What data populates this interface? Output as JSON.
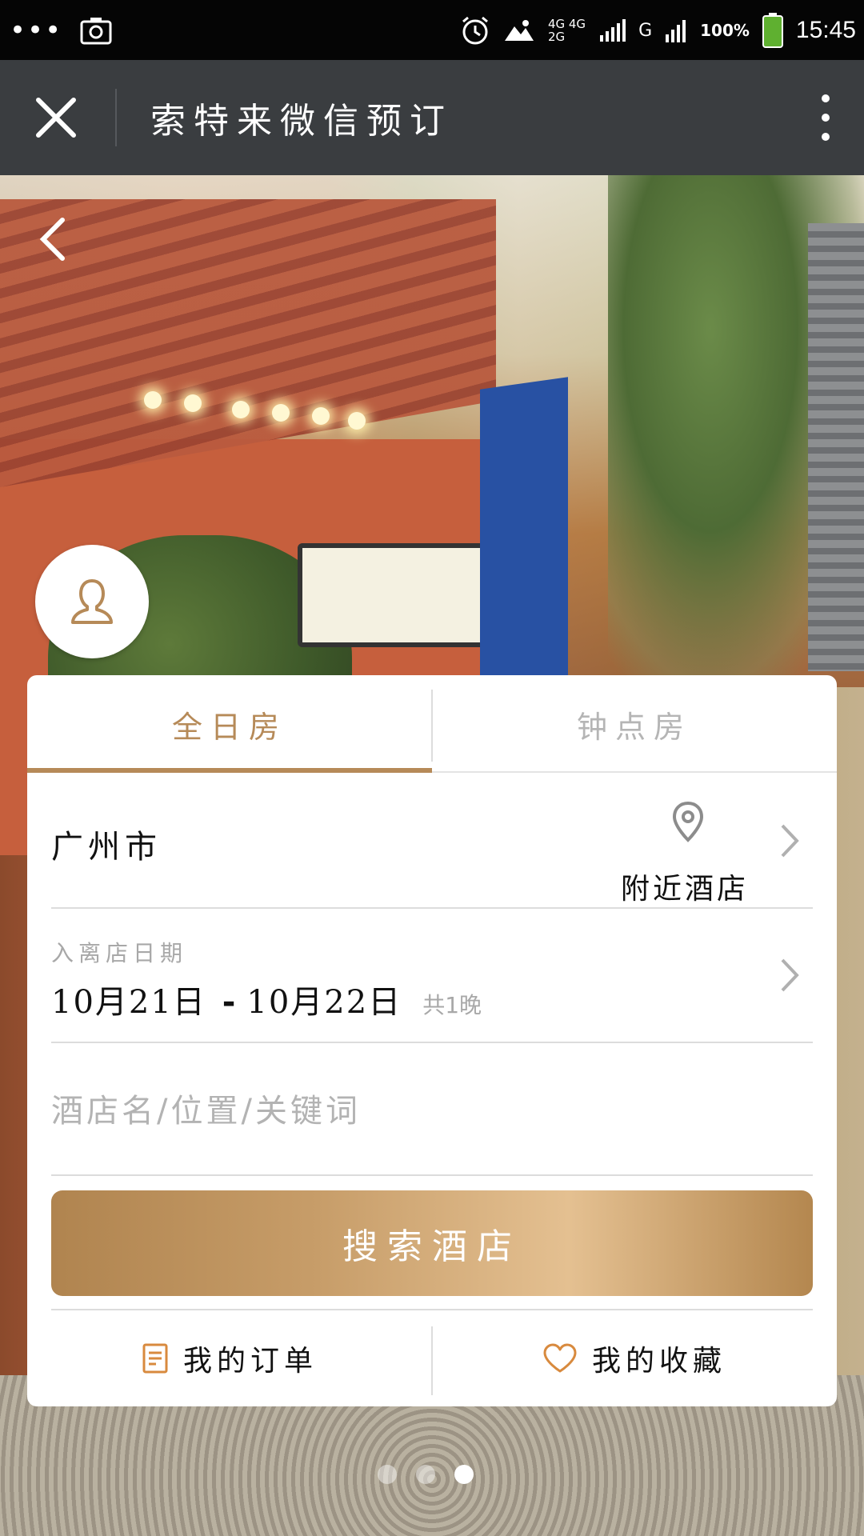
{
  "status_bar": {
    "net_top": "4G 4G",
    "net_bottom": "2G",
    "signal": "G",
    "battery": "100%",
    "time": "15:45"
  },
  "titlebar": {
    "title": "索特来微信预订"
  },
  "tabs": [
    {
      "label": "全日房",
      "active": true
    },
    {
      "label": "钟点房",
      "active": false
    }
  ],
  "city": {
    "name": "广州市",
    "nearby_label": "附近酒店"
  },
  "dates": {
    "caption": "入离店日期",
    "check_in": "10月21日",
    "check_out": "10月22日",
    "nights": "共1晚"
  },
  "search": {
    "placeholder": "酒店名/位置/关键词",
    "button_label": "搜索酒店"
  },
  "bottom_links": {
    "orders": "我的订单",
    "favorites": "我的收藏"
  },
  "carousel": {
    "count": 3,
    "active_index": 2
  },
  "colors": {
    "accent": "#b68a58",
    "titlebar": "#3a3d40",
    "inactive_text": "#b5b5b5"
  }
}
